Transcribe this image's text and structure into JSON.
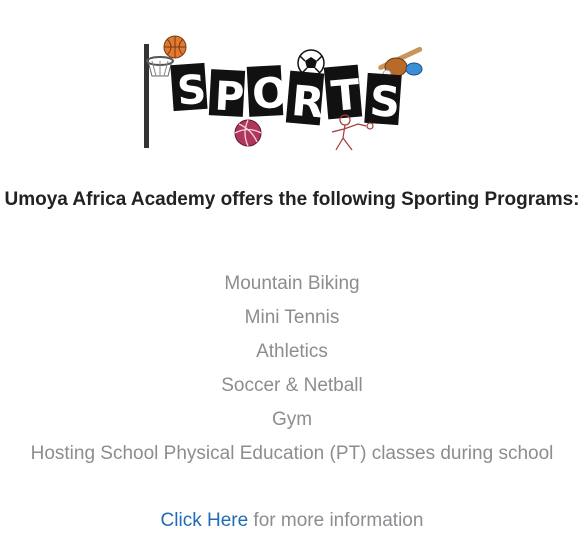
{
  "logo": {
    "alt_text": "SPORTS",
    "icons": [
      "basketball-icon",
      "soccer-ball-icon",
      "baseball-glove-icon",
      "volleyball-icon",
      "netball-player-icon",
      "basketball-hoop-icon"
    ]
  },
  "headline": "Umoya Africa Academy offers the following Sporting Programs:",
  "programs": [
    "Mountain Biking",
    "Mini Tennis",
    "Athletics",
    "Soccer & Netball",
    "Gym",
    "Hosting School Physical Education (PT) classes during school"
  ],
  "more_info": {
    "link_label": "Click Here",
    "suffix": " for more information"
  },
  "colors": {
    "headline": "#222222",
    "list_text": "#8b8d90",
    "link": "#1f6bb5",
    "ball_orange": "#e07a2e",
    "volleyball_pink": "#b0365c"
  }
}
